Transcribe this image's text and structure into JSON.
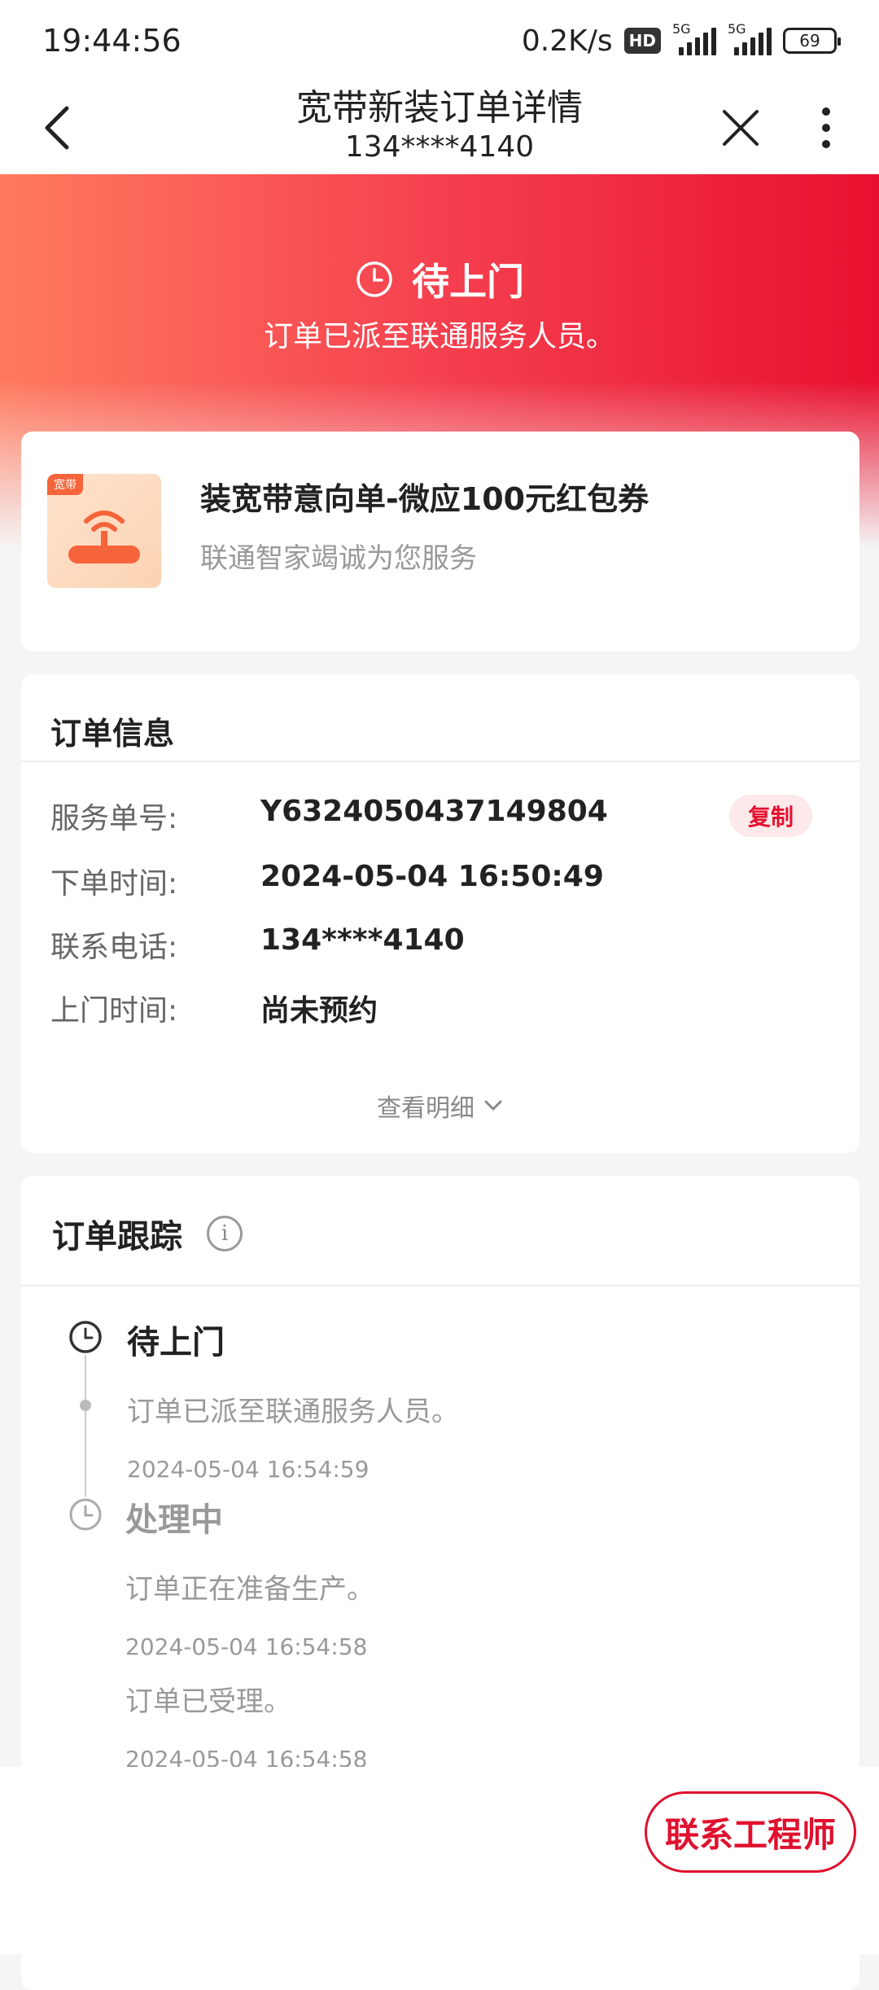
{
  "status_bar": {
    "time": "19:44:56",
    "net_speed": "0.2K/s",
    "hd_label": "HD",
    "signal1_label": "5G",
    "signal2_label": "5G",
    "battery": "69"
  },
  "nav": {
    "title": "宽带新装订单详情",
    "subtitle": "134****4140"
  },
  "hero": {
    "status": "待上门",
    "description": "订单已派至联通服务人员。"
  },
  "product": {
    "tag": "宽带",
    "name": "装宽带意向单-微应100元红包券",
    "subtitle": "联通智家竭诚为您服务"
  },
  "order_info": {
    "title": "订单信息",
    "rows": [
      {
        "label": "服务单号:",
        "value": "Y6324050437149804"
      },
      {
        "label": "下单时间:",
        "value": "2024-05-04 16:50:49"
      },
      {
        "label": "联系电话:",
        "value": "134****4140"
      },
      {
        "label": "上门时间:",
        "value": "尚未预约"
      }
    ],
    "copy_label": "复制",
    "view_more": "查看明细"
  },
  "tracking": {
    "title": "订单跟踪",
    "events": [
      {
        "status": "待上门",
        "text": "订单已派至联通服务人员。",
        "time": "2024-05-04 16:54:59"
      },
      {
        "status": "处理中",
        "text": "订单正在准备生产。",
        "time": "2024-05-04 16:54:58"
      },
      {
        "status": "",
        "text": "订单已受理。",
        "time": "2024-05-04 16:54:58"
      }
    ]
  },
  "bottom": {
    "contact_label": "联系工程师"
  },
  "colors": {
    "brand_red": "#e0102e",
    "hero_start": "#ff7a5e",
    "hero_end": "#e8102e"
  }
}
